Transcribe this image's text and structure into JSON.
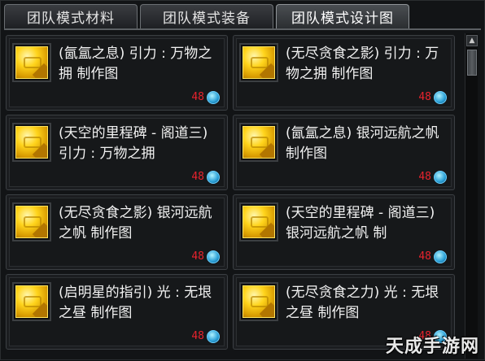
{
  "tabs": [
    {
      "label": "团队模式材料"
    },
    {
      "label": "团队模式装备"
    },
    {
      "label": "团队模式设计图"
    }
  ],
  "items": [
    {
      "name": "(氤氲之息) 引力 : 万物之拥 制作图",
      "count": "48"
    },
    {
      "name": "(无尽贪食之影) 引力 : 万物之拥 制作图",
      "count": "48"
    },
    {
      "name": "(天空的里程碑 - 阁道三) 引力 : 万物之拥",
      "count": "48"
    },
    {
      "name": "(氤氲之息) 银河远航之帆 制作图",
      "count": "48"
    },
    {
      "name": "(无尽贪食之影) 银河远航之帆 制作图",
      "count": "48"
    },
    {
      "name": "(天空的里程碑 - 阁道三) 银河远航之帆 制",
      "count": "48"
    },
    {
      "name": "(启明星的指引) 光 : 无垠之昼 制作图",
      "count": "48"
    },
    {
      "name": "(无尽贪食之力) 光 : 无垠之昼 制作图",
      "count": "48"
    }
  ],
  "scrollbar": {
    "up_arrow": "▲"
  },
  "watermark": "天成手游网",
  "colors": {
    "count": "#e8232d",
    "accent": "#ffd41c"
  }
}
